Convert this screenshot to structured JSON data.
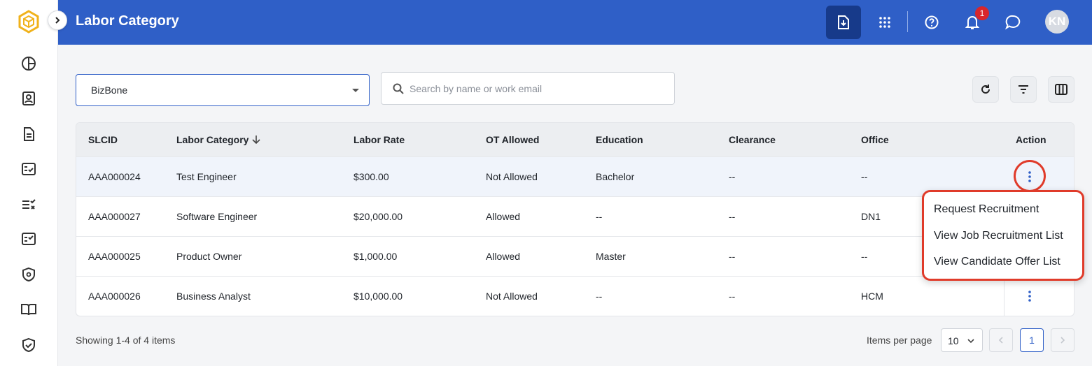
{
  "header": {
    "title": "Labor Category",
    "notification_count": "1",
    "avatar_initials": "KN"
  },
  "filters": {
    "company_selected": "BizBone",
    "search_placeholder": "Search by name or work email"
  },
  "table": {
    "columns": [
      "SLCID",
      "Labor Category",
      "Labor Rate",
      "OT Allowed",
      "Education",
      "Clearance",
      "Office",
      "Action"
    ],
    "sort_column": "Labor Category",
    "rows": [
      {
        "slcid": "AAA000024",
        "category": "Test Engineer",
        "rate": "$300.00",
        "ot": "Not Allowed",
        "education": "Bachelor",
        "clearance": "--",
        "office": "--"
      },
      {
        "slcid": "AAA000027",
        "category": "Software Engineer",
        "rate": "$20,000.00",
        "ot": "Allowed",
        "education": "--",
        "clearance": "--",
        "office": "DN1"
      },
      {
        "slcid": "AAA000025",
        "category": "Product Owner",
        "rate": "$1,000.00",
        "ot": "Allowed",
        "education": "Master",
        "clearance": "--",
        "office": "--"
      },
      {
        "slcid": "AAA000026",
        "category": "Business Analyst",
        "rate": "$10,000.00",
        "ot": "Not Allowed",
        "education": "--",
        "clearance": "--",
        "office": "HCM"
      }
    ]
  },
  "action_menu": {
    "items": [
      "Request Recruitment",
      "View Job Recruitment List",
      "View Candidate Offer List"
    ]
  },
  "footer": {
    "showing": "Showing 1-4 of 4 items",
    "items_per_page_label": "Items per page",
    "items_per_page": "10",
    "current_page": "1"
  },
  "colors": {
    "primary": "#2f5fc7",
    "highlight": "#e03b2a",
    "badge": "#d8262c"
  },
  "icons": {
    "sidebar": [
      "pie-chart-icon",
      "contact-card-icon",
      "document-icon",
      "checklist-icon",
      "list-check-icon",
      "task-list-icon",
      "shield-at-icon",
      "open-book-icon",
      "shield-check-icon"
    ],
    "topbar": [
      "download-doc-icon",
      "apps-grid-icon",
      "help-icon",
      "bell-icon",
      "chat-icon"
    ]
  }
}
